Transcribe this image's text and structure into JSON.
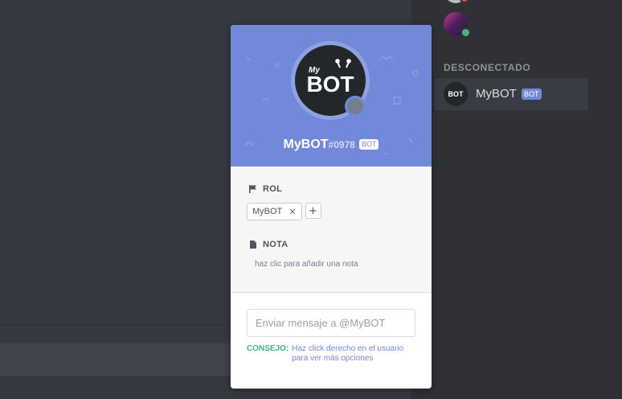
{
  "members": {
    "section_label": "DESCONECTADO",
    "bot_row": {
      "name": "MyBOT",
      "badge": "BOT",
      "avatar_text": "BOT"
    }
  },
  "popout": {
    "username": "MyBOT",
    "discriminator": "#0978",
    "badge": "BOT",
    "avatar": {
      "logo_small": "My",
      "logo_big": "BOT"
    },
    "role_section": {
      "title": "ROL",
      "roles": [
        {
          "label": "MyBOT"
        }
      ],
      "add_label": "+"
    },
    "note_section": {
      "title": "NOTA",
      "placeholder": "haz clic para añadir una nota"
    },
    "message": {
      "placeholder": "Enviar mensaje a @MyBOT"
    },
    "tip": {
      "label": "CONSEJO:",
      "text": "Haz click derecho en el usuario para ver más opciones"
    }
  },
  "colors": {
    "blurple": "#7289da",
    "online": "#43b581",
    "offline": "#747f8d",
    "dnd": "#f04747",
    "background_dark": "#36393f",
    "sidebar": "#2f3136"
  },
  "icons": [
    "flag-icon",
    "note-icon",
    "close-icon",
    "plus-icon"
  ]
}
